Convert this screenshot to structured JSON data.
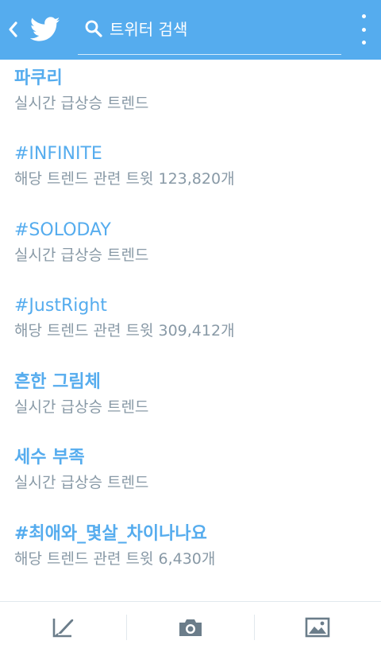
{
  "header": {
    "search_placeholder": "트위터 검색",
    "back_icon": "chevron-left-icon",
    "logo_icon": "twitter-bird-icon",
    "menu_icon": "overflow-menu-icon",
    "accent_color": "#55acee"
  },
  "trends": [
    {
      "name": "파쿠리",
      "sub": "실시간 급상승 트렌드",
      "count": ""
    },
    {
      "name": "#INFINITE",
      "sub": "해당 트렌드 관련 트윗",
      "count": "123,820개"
    },
    {
      "name": "#SOLODAY",
      "sub": "실시간 급상승 트렌드",
      "count": ""
    },
    {
      "name": "#JustRight",
      "sub": "해당 트렌드 관련 트윗",
      "count": "309,412개"
    },
    {
      "name": "흔한 그림체",
      "sub": "실시간 급상승 트렌드",
      "count": ""
    },
    {
      "name": "세수 부족",
      "sub": "실시간 급상승 트렌드",
      "count": ""
    },
    {
      "name": "#최애와_몇살_차이나나요",
      "sub": "해당 트렌드 관련 트윗",
      "count": "6,430개"
    }
  ],
  "bottom_bar": {
    "compose_icon": "compose-tweet-icon",
    "camera_icon": "camera-icon",
    "gallery_icon": "image-gallery-icon"
  }
}
